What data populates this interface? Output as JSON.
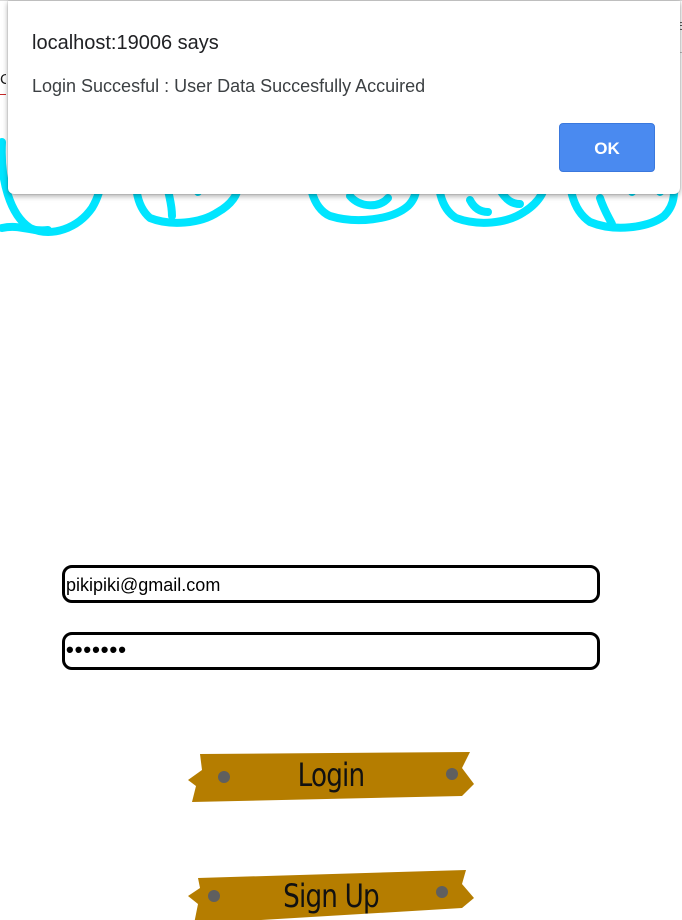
{
  "dialog": {
    "title": "localhost:19006 says",
    "message": "Login Succesful : User Data Succesfully Accuired",
    "ok_label": "OK"
  },
  "login_form": {
    "email_value": "pikipiki@gmail.com",
    "password_value": "•••••••"
  },
  "buttons": {
    "login_label": "Login",
    "signup_label": "Sign Up"
  },
  "colors": {
    "tape": "#b57d00",
    "tape_dot": "#5f5f5f",
    "doodle": "#00e5ff",
    "ok_button": "#4a8af0"
  }
}
